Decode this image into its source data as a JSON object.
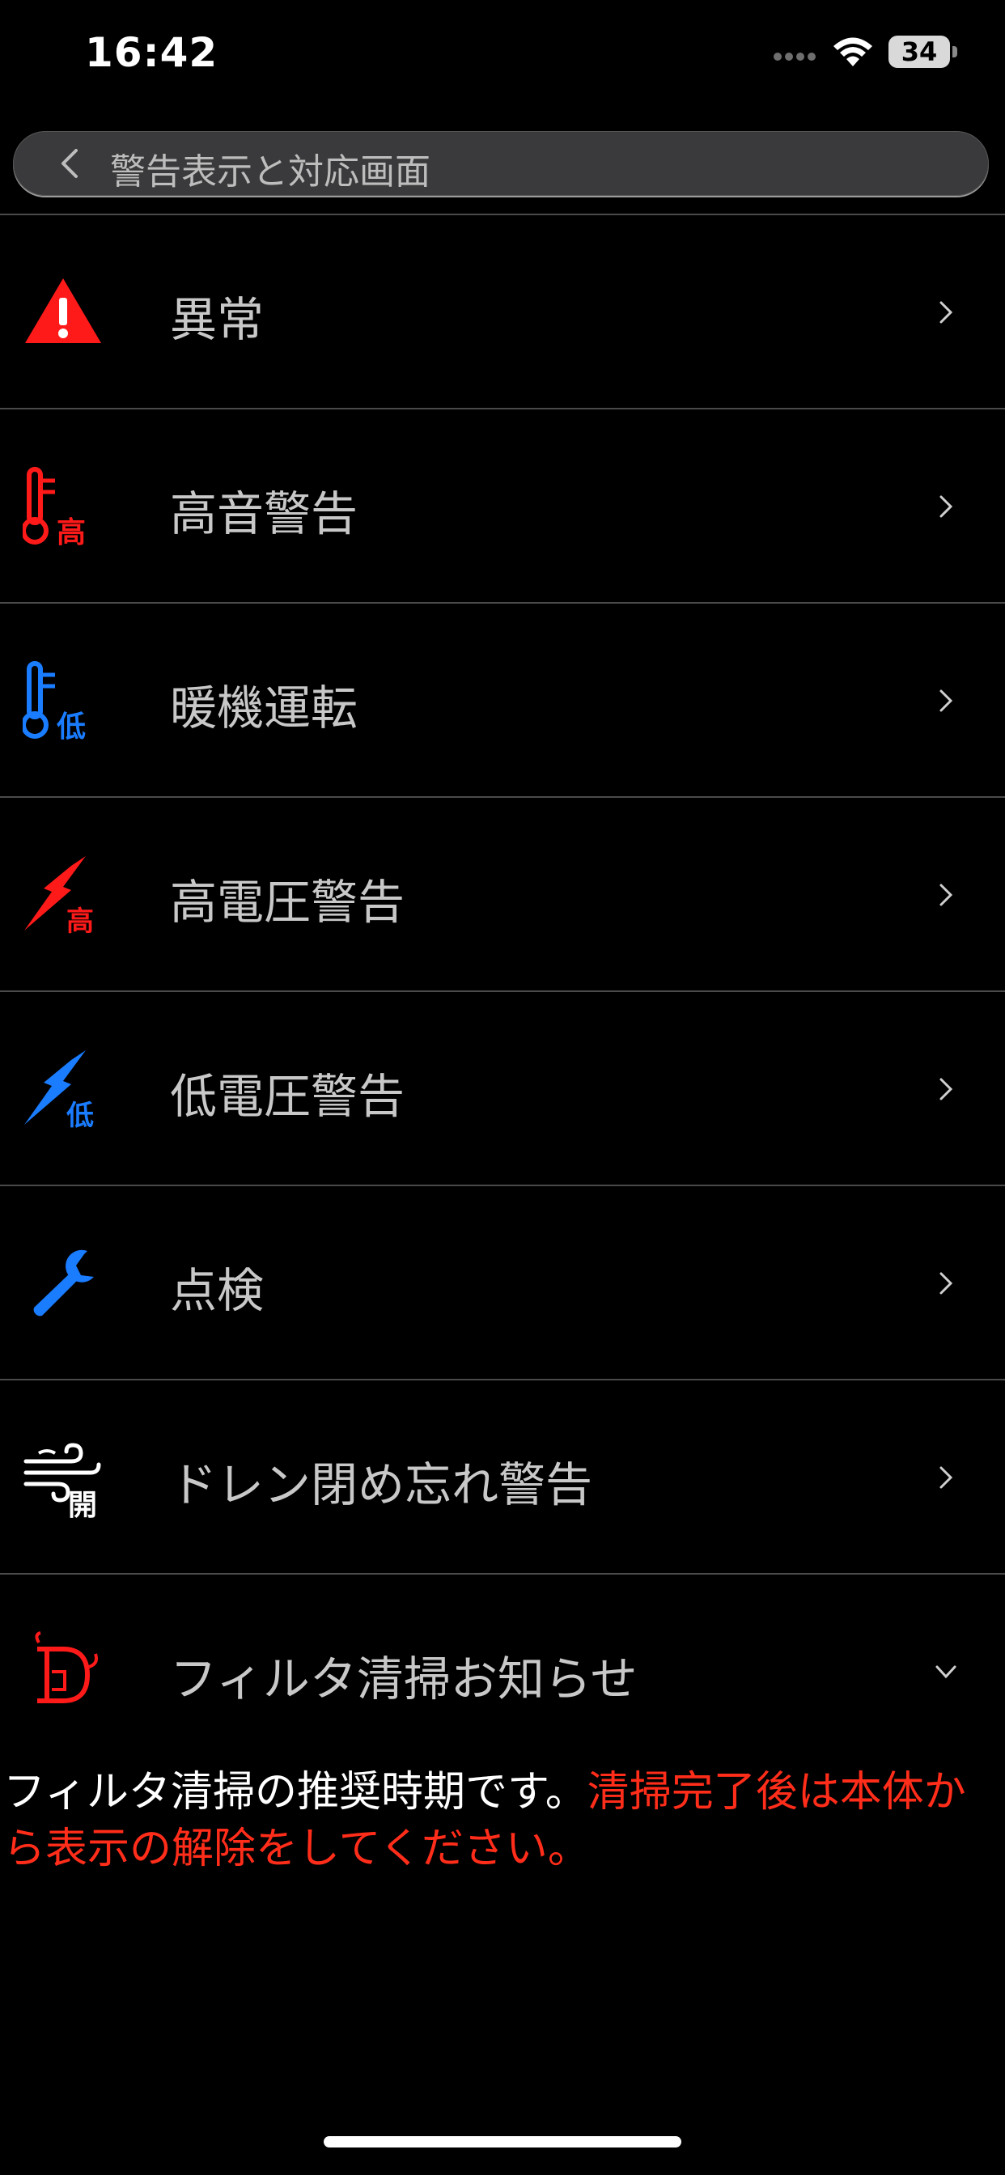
{
  "status": {
    "time": "16:42",
    "battery": "34"
  },
  "nav": {
    "title": "警告表示と対応画面"
  },
  "items": [
    {
      "label": "異常",
      "icon": "warning-triangle-icon"
    },
    {
      "label": "高音警告",
      "icon": "thermometer-high-icon",
      "badge": "高"
    },
    {
      "label": "暖機運転",
      "icon": "thermometer-low-icon",
      "badge": "低"
    },
    {
      "label": "高電圧警告",
      "icon": "lightning-high-icon",
      "badge": "高"
    },
    {
      "label": "低電圧警告",
      "icon": "lightning-low-icon",
      "badge": "低"
    },
    {
      "label": "点検",
      "icon": "wrench-icon"
    },
    {
      "label": "ドレン閉め忘れ警告",
      "icon": "wind-open-icon",
      "badge": "開"
    },
    {
      "label": "フィルタ清掃お知らせ",
      "icon": "filter-icon"
    }
  ],
  "message": {
    "white": "フィルタ清掃の推奨時期です。",
    "red": "清掃完了後は本体から表示の解除をしてください。"
  },
  "colors": {
    "red": "#ff1a1a",
    "blue": "#1a7cff",
    "background": "#000000"
  }
}
